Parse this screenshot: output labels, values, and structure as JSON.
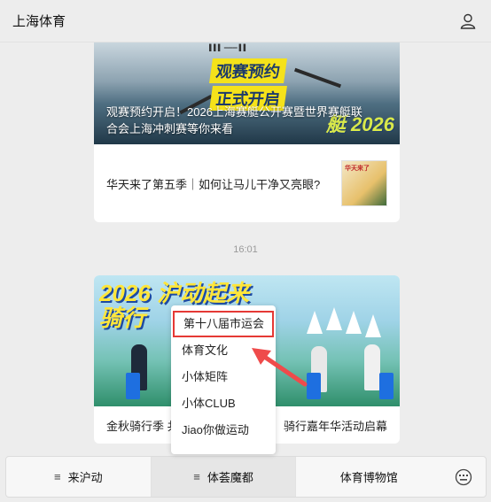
{
  "header": {
    "title": "上海体育",
    "user_icon": "user-icon"
  },
  "article1": {
    "badge_line1": "观赛预约",
    "badge_line2": "正式开启",
    "caption": "观赛预约开启！2026上海赛艇公开赛暨世界赛艇联合会上海冲刺赛等你来看",
    "sub_title": "华天来了第五季｜如何让马儿干净又亮眼?"
  },
  "timestamp": "16:01",
  "article2": {
    "banner_text_line1": "2026 沪动起来",
    "banner_text_line2": "骑行",
    "caption_left": "金秋骑行季 共",
    "caption_right": "骑行嘉年华活动启幕"
  },
  "popup_menu": {
    "items": [
      {
        "label": "第十八届市运会",
        "highlighted": true
      },
      {
        "label": "体育文化"
      },
      {
        "label": "小体矩阵"
      },
      {
        "label": "小体CLUB"
      },
      {
        "label": "Jiao你做运动"
      }
    ]
  },
  "tabbar": {
    "tabs": [
      {
        "label": "来沪动",
        "icon": "menu-icon"
      },
      {
        "label": "体荟魔都",
        "icon": "menu-icon",
        "active": true
      },
      {
        "label": "体育博物馆"
      }
    ],
    "keyboard_icon": "keyboard-icon"
  },
  "colors": {
    "highlight_border": "#e53935",
    "arrow": "#ef4b4b",
    "background": "#ededed"
  }
}
